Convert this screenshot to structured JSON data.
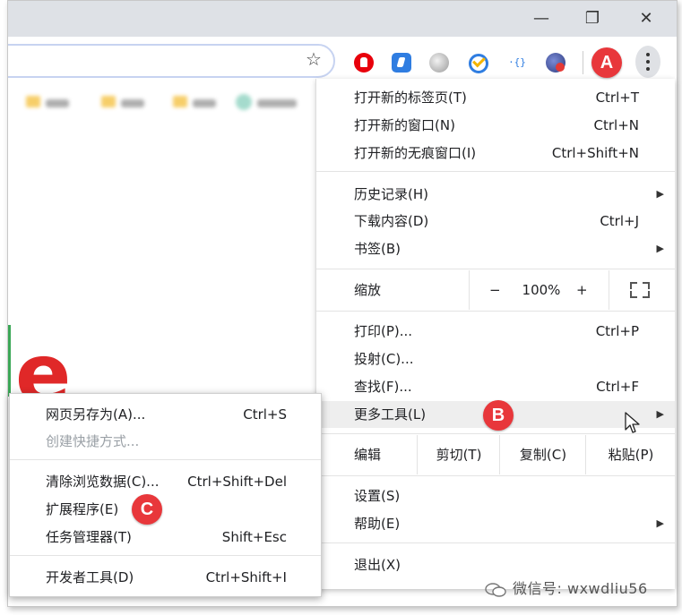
{
  "window": {
    "minimize": "—",
    "restore": "❐",
    "close": "✕"
  },
  "toolbar": {
    "star": "☆",
    "json_ext": "·{}"
  },
  "menu_button_badge": "A",
  "main_menu": {
    "items_top": [
      {
        "label": "打开新的标签页(T)",
        "shortcut": "Ctrl+T"
      },
      {
        "label": "打开新的窗口(N)",
        "shortcut": "Ctrl+N"
      },
      {
        "label": "打开新的无痕窗口(I)",
        "shortcut": "Ctrl+Shift+N"
      }
    ],
    "items_history": [
      {
        "label": "历史记录(H)",
        "shortcut": "",
        "arrow": "▶"
      },
      {
        "label": "下载内容(D)",
        "shortcut": "Ctrl+J",
        "arrow": ""
      },
      {
        "label": "书签(B)",
        "shortcut": "",
        "arrow": "▶"
      }
    ],
    "zoom": {
      "label": "缩放",
      "minus": "−",
      "value": "100%",
      "plus": "+"
    },
    "items_print": [
      {
        "label": "打印(P)...",
        "shortcut": "Ctrl+P"
      },
      {
        "label": "投射(C)...",
        "shortcut": ""
      },
      {
        "label": "查找(F)...",
        "shortcut": "Ctrl+F"
      },
      {
        "label": "更多工具(L)",
        "shortcut": "",
        "arrow": "▶"
      }
    ],
    "edit": {
      "label": "编辑",
      "cut": "剪切(T)",
      "copy": "复制(C)",
      "paste": "粘贴(P)"
    },
    "items_settings": [
      {
        "label": "设置(S)",
        "arrow": ""
      },
      {
        "label": "帮助(E)",
        "arrow": "▶"
      }
    ],
    "exit": "退出(X)"
  },
  "more_tools_badge": "B",
  "sub_menu": {
    "items": [
      {
        "label": "网页另存为(A)...",
        "shortcut": "Ctrl+S"
      },
      {
        "label": "创建快捷方式...",
        "shortcut": ""
      },
      {
        "label": "清除浏览数据(C)...",
        "shortcut": "Ctrl+Shift+Del"
      },
      {
        "label": "扩展程序(E)",
        "shortcut": ""
      },
      {
        "label": "任务管理器(T)",
        "shortcut": "Shift+Esc"
      },
      {
        "label": "开发者工具(D)",
        "shortcut": "Ctrl+Shift+I"
      }
    ]
  },
  "extensions_badge": "C",
  "page_logo": "e",
  "watermark": "微信号: wxwdliu56",
  "colors": {
    "badge": "#e8373b",
    "accent_blue": "#2f7de1",
    "menu_hover": "#eeeeee"
  }
}
